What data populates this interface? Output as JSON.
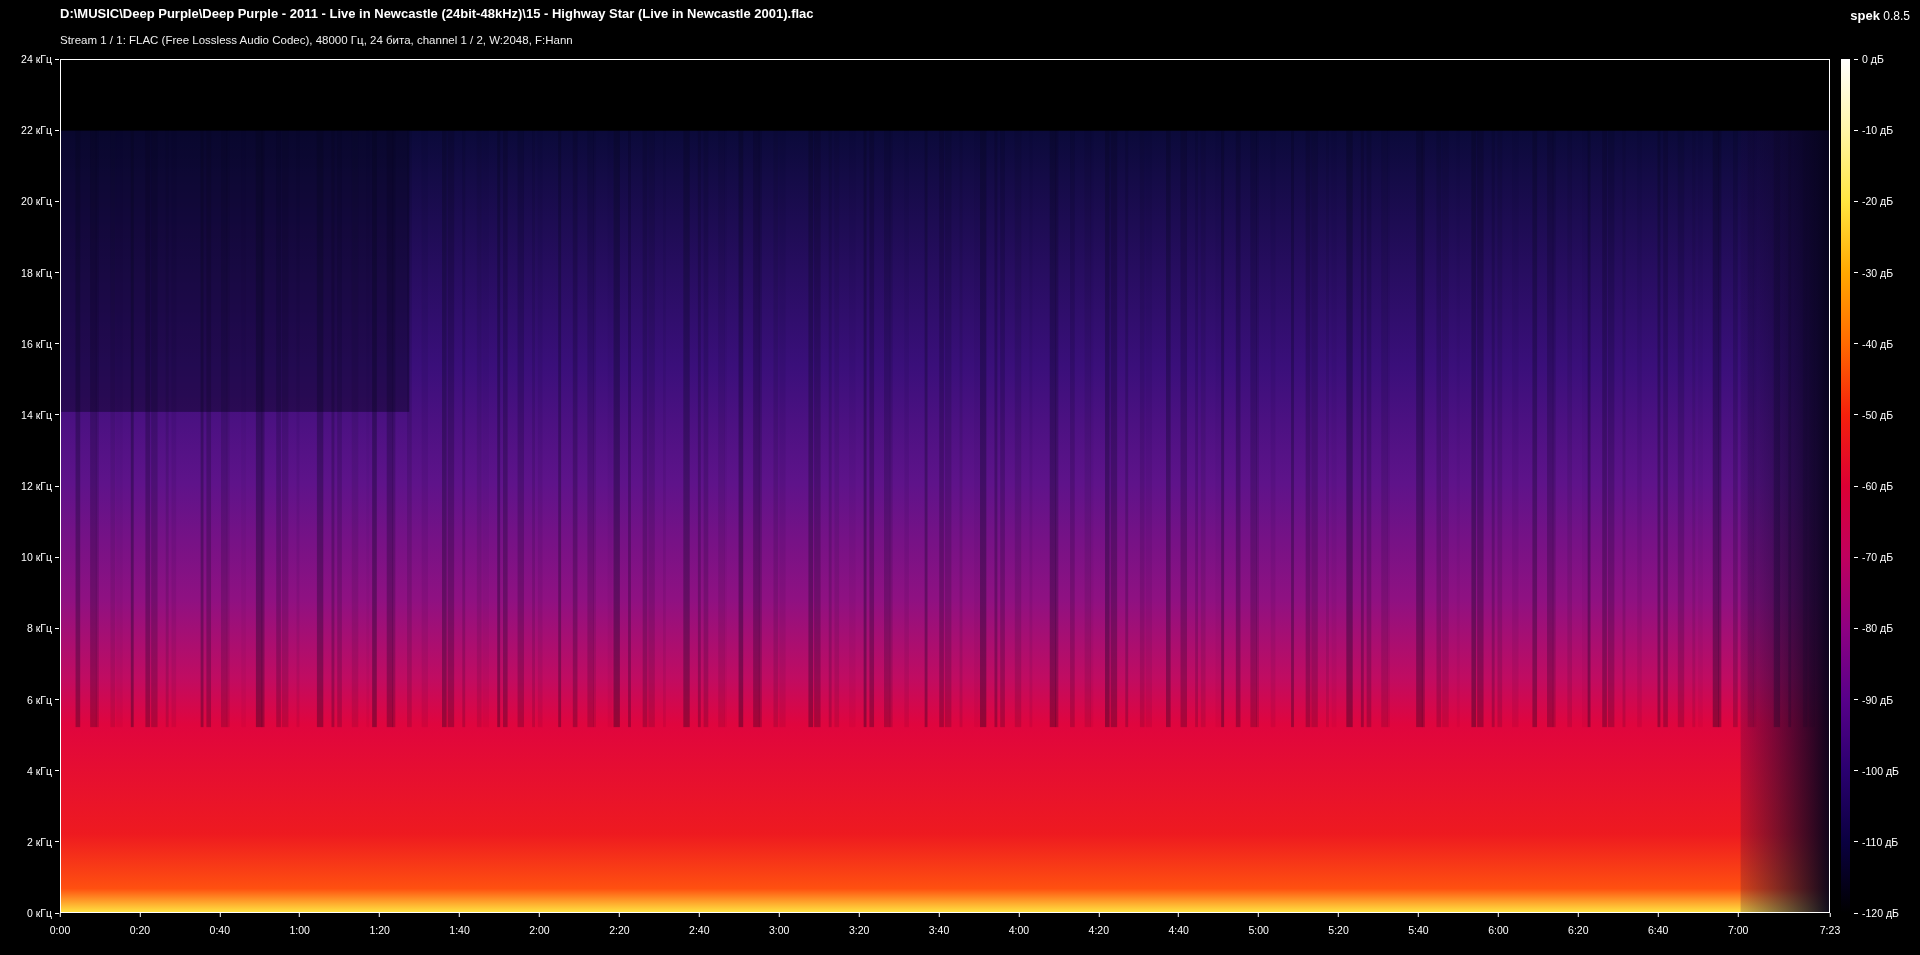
{
  "title": "D:\\MUSIC\\Deep Purple\\Deep Purple - 2011 - Live in Newcastle (24bit-48kHz)\\15 - Highway Star (Live in Newcastle 2001).flac",
  "stream_info": "Stream 1 / 1: FLAC (Free Lossless Audio Codec), 48000 Гц, 24 бита, channel 1 / 2, W:2048, F:Hann",
  "app": {
    "name": "spek",
    "version": "0.8.5"
  },
  "frequency_ticks": [
    "24 кГц",
    "22 кГц",
    "20 кГц",
    "18 кГц",
    "16 кГц",
    "14 кГц",
    "12 кГц",
    "10 кГц",
    "8 кГц",
    "6 кГц",
    "4 кГц",
    "2 кГц",
    "0 кГц"
  ],
  "time_ticks": [
    "0:00",
    "0:20",
    "0:40",
    "1:00",
    "1:20",
    "1:40",
    "2:00",
    "2:20",
    "2:40",
    "3:00",
    "3:20",
    "3:40",
    "4:00",
    "4:20",
    "4:40",
    "5:00",
    "5:20",
    "5:40",
    "6:00",
    "6:20",
    "6:40",
    "7:00"
  ],
  "end_time": "7:23",
  "db_ticks": [
    "0 дБ",
    "-10 дБ",
    "-20 дБ",
    "-30 дБ",
    "-40 дБ",
    "-50 дБ",
    "-60 дБ",
    "-70 дБ",
    "-80 дБ",
    "-90 дБ",
    "-100 дБ",
    "-110 дБ",
    "-120 дБ"
  ]
}
